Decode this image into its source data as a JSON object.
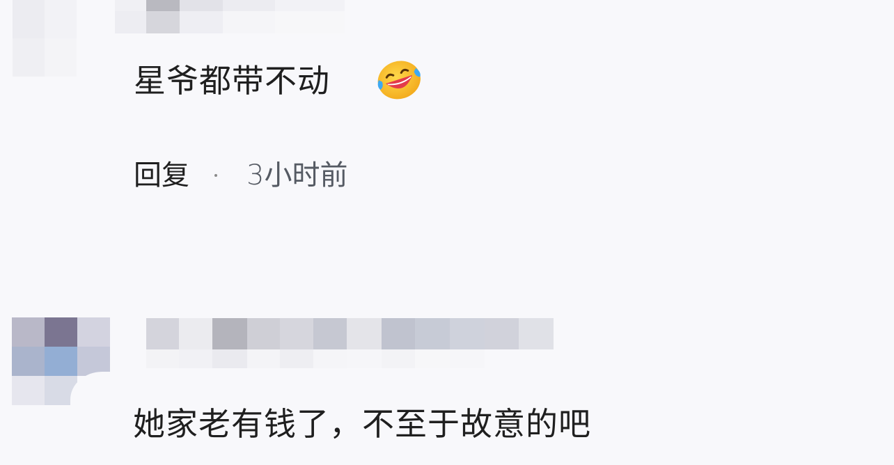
{
  "comments": [
    {
      "text": "星爷都带不动",
      "emoji": "laugh-cry-emoji",
      "reply_label": "回复",
      "time": "3小时前"
    },
    {
      "text": "她家老有钱了，不至于故意的吧"
    }
  ],
  "mosaic_colors": {
    "avatar_top": [
      "#e3e3e9",
      "#eeeef2",
      "#e8e8ee",
      "#f1f1f5"
    ],
    "name_top": [
      "#f0f0f4",
      "#b9b9c0",
      "#e2e2e8",
      "#ececf1",
      "#f2f2f6",
      "#ededf2",
      "#d6d6dc",
      "#eeeef3",
      "#f5f5f8",
      "#f7f7f9"
    ],
    "avatar_bottom": [
      "#b9b8c8",
      "#7b7591",
      "#d3d3e0",
      "#aab4cc",
      "#93aed4",
      "#c5c8d9",
      "#e6e6ee",
      "#d8dbe6",
      "#f8f8fb"
    ],
    "name_bottom": [
      "#d4d4dc",
      "#ebebef",
      "#b4b4bc",
      "#cfcfd6",
      "#d6d6dd",
      "#c6c8d2",
      "#e4e4e9",
      "#c0c3cf",
      "#c7cbd6",
      "#cfd2dc",
      "#d1d2db",
      "#e0e1e7",
      "#f3f3f6",
      "#f1f1f5",
      "#eaeaef",
      "#f4f4f7",
      "#eeeef2",
      "#f5f5f8",
      "#f6f6f9",
      "#f3f3f6",
      "#f7f7f9",
      "#f6f6f9",
      "#f8f8fb",
      "#f8f8fb"
    ]
  }
}
